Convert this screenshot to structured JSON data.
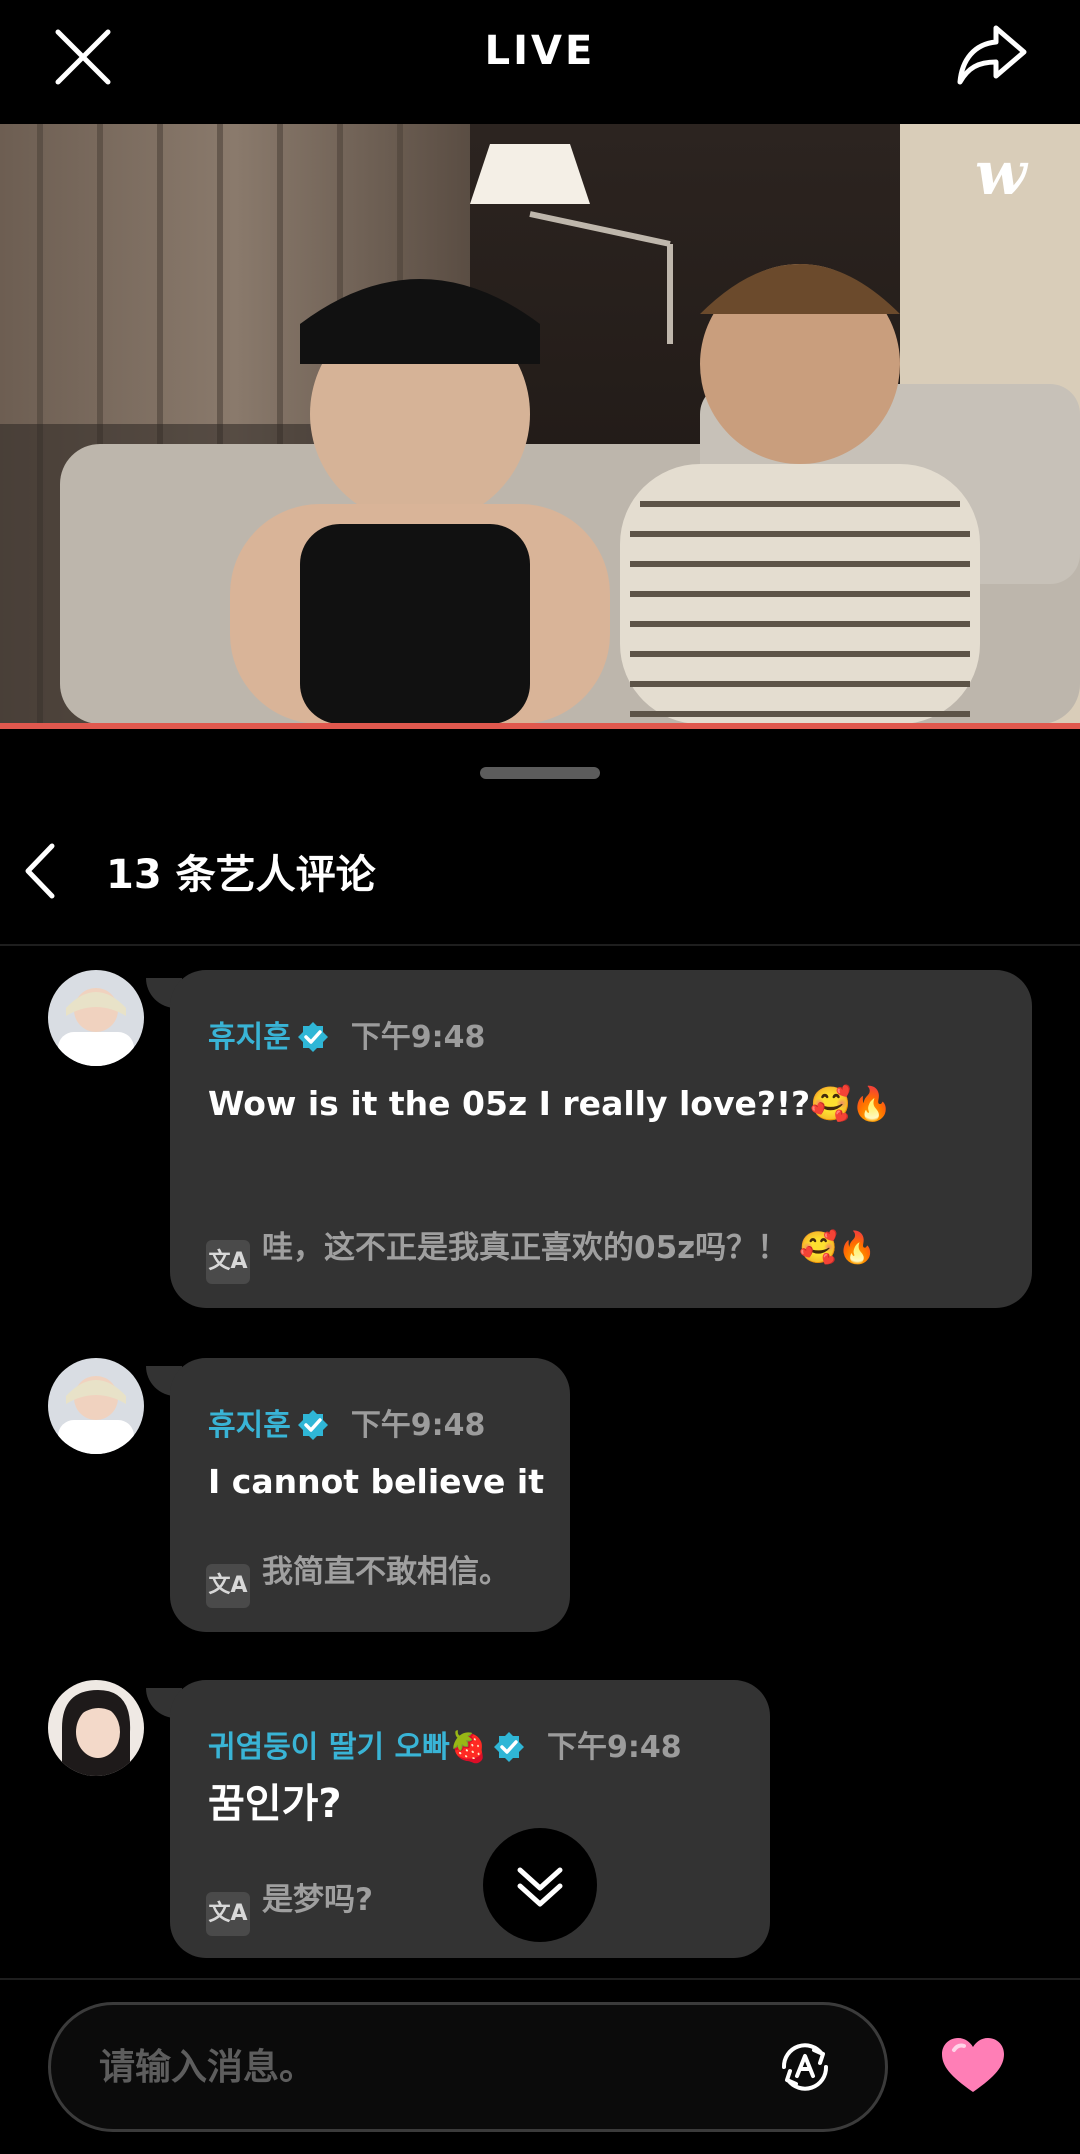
{
  "header": {
    "title": "LIVE"
  },
  "video": {
    "watermark": "w"
  },
  "comments": {
    "count": "13",
    "title_suffix": "条艺人评论",
    "items": [
      {
        "author": "휴지훈",
        "time": "下午9:48",
        "text": "Wow is it the 05z      I really love?!?🥰🔥",
        "translation": "哇，这不正是我真正喜欢的05z吗？！ 🥰🔥"
      },
      {
        "author": "휴지훈",
        "time": "下午9:48",
        "text": "I cannot believe it",
        "translation": "我简直不敢相信。"
      },
      {
        "author": "귀염둥이 딸기 오빠🍓",
        "time": "下午9:48",
        "text": "꿈인가?",
        "translation": "是梦吗?"
      }
    ]
  },
  "composer": {
    "placeholder": "请输入消息。"
  },
  "icons": {
    "close": "close-icon",
    "share": "share-icon",
    "back": "chevron-left-icon",
    "verified": "verified-badge-icon",
    "translate": "translate-icon",
    "scroll_down": "double-chevron-down-icon",
    "translate_toggle": "auto-translate-icon",
    "heart": "heart-icon"
  },
  "colors": {
    "accent_name": "#39b4d6",
    "progress": "#e0584e",
    "heart": "#ff7eb6"
  }
}
